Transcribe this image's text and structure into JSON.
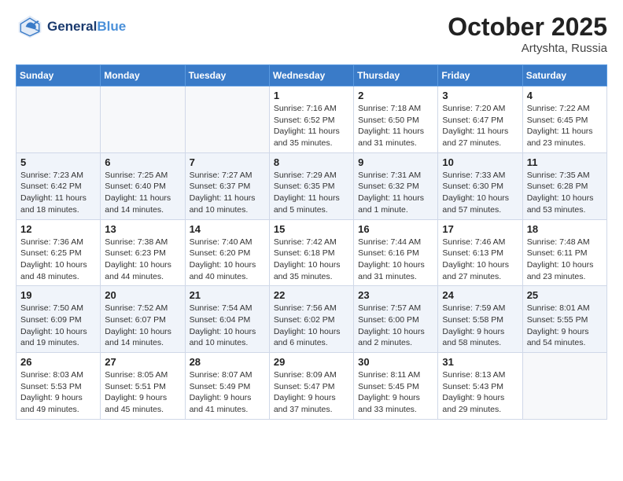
{
  "logo": {
    "line1": "General",
    "line2": "Blue"
  },
  "title": "October 2025",
  "location": "Artyshta, Russia",
  "weekdays": [
    "Sunday",
    "Monday",
    "Tuesday",
    "Wednesday",
    "Thursday",
    "Friday",
    "Saturday"
  ],
  "weeks": [
    [
      {
        "day": "",
        "info": ""
      },
      {
        "day": "",
        "info": ""
      },
      {
        "day": "",
        "info": ""
      },
      {
        "day": "1",
        "info": "Sunrise: 7:16 AM\nSunset: 6:52 PM\nDaylight: 11 hours\nand 35 minutes."
      },
      {
        "day": "2",
        "info": "Sunrise: 7:18 AM\nSunset: 6:50 PM\nDaylight: 11 hours\nand 31 minutes."
      },
      {
        "day": "3",
        "info": "Sunrise: 7:20 AM\nSunset: 6:47 PM\nDaylight: 11 hours\nand 27 minutes."
      },
      {
        "day": "4",
        "info": "Sunrise: 7:22 AM\nSunset: 6:45 PM\nDaylight: 11 hours\nand 23 minutes."
      }
    ],
    [
      {
        "day": "5",
        "info": "Sunrise: 7:23 AM\nSunset: 6:42 PM\nDaylight: 11 hours\nand 18 minutes."
      },
      {
        "day": "6",
        "info": "Sunrise: 7:25 AM\nSunset: 6:40 PM\nDaylight: 11 hours\nand 14 minutes."
      },
      {
        "day": "7",
        "info": "Sunrise: 7:27 AM\nSunset: 6:37 PM\nDaylight: 11 hours\nand 10 minutes."
      },
      {
        "day": "8",
        "info": "Sunrise: 7:29 AM\nSunset: 6:35 PM\nDaylight: 11 hours\nand 5 minutes."
      },
      {
        "day": "9",
        "info": "Sunrise: 7:31 AM\nSunset: 6:32 PM\nDaylight: 11 hours\nand 1 minute."
      },
      {
        "day": "10",
        "info": "Sunrise: 7:33 AM\nSunset: 6:30 PM\nDaylight: 10 hours\nand 57 minutes."
      },
      {
        "day": "11",
        "info": "Sunrise: 7:35 AM\nSunset: 6:28 PM\nDaylight: 10 hours\nand 53 minutes."
      }
    ],
    [
      {
        "day": "12",
        "info": "Sunrise: 7:36 AM\nSunset: 6:25 PM\nDaylight: 10 hours\nand 48 minutes."
      },
      {
        "day": "13",
        "info": "Sunrise: 7:38 AM\nSunset: 6:23 PM\nDaylight: 10 hours\nand 44 minutes."
      },
      {
        "day": "14",
        "info": "Sunrise: 7:40 AM\nSunset: 6:20 PM\nDaylight: 10 hours\nand 40 minutes."
      },
      {
        "day": "15",
        "info": "Sunrise: 7:42 AM\nSunset: 6:18 PM\nDaylight: 10 hours\nand 35 minutes."
      },
      {
        "day": "16",
        "info": "Sunrise: 7:44 AM\nSunset: 6:16 PM\nDaylight: 10 hours\nand 31 minutes."
      },
      {
        "day": "17",
        "info": "Sunrise: 7:46 AM\nSunset: 6:13 PM\nDaylight: 10 hours\nand 27 minutes."
      },
      {
        "day": "18",
        "info": "Sunrise: 7:48 AM\nSunset: 6:11 PM\nDaylight: 10 hours\nand 23 minutes."
      }
    ],
    [
      {
        "day": "19",
        "info": "Sunrise: 7:50 AM\nSunset: 6:09 PM\nDaylight: 10 hours\nand 19 minutes."
      },
      {
        "day": "20",
        "info": "Sunrise: 7:52 AM\nSunset: 6:07 PM\nDaylight: 10 hours\nand 14 minutes."
      },
      {
        "day": "21",
        "info": "Sunrise: 7:54 AM\nSunset: 6:04 PM\nDaylight: 10 hours\nand 10 minutes."
      },
      {
        "day": "22",
        "info": "Sunrise: 7:56 AM\nSunset: 6:02 PM\nDaylight: 10 hours\nand 6 minutes."
      },
      {
        "day": "23",
        "info": "Sunrise: 7:57 AM\nSunset: 6:00 PM\nDaylight: 10 hours\nand 2 minutes."
      },
      {
        "day": "24",
        "info": "Sunrise: 7:59 AM\nSunset: 5:58 PM\nDaylight: 9 hours\nand 58 minutes."
      },
      {
        "day": "25",
        "info": "Sunrise: 8:01 AM\nSunset: 5:55 PM\nDaylight: 9 hours\nand 54 minutes."
      }
    ],
    [
      {
        "day": "26",
        "info": "Sunrise: 8:03 AM\nSunset: 5:53 PM\nDaylight: 9 hours\nand 49 minutes."
      },
      {
        "day": "27",
        "info": "Sunrise: 8:05 AM\nSunset: 5:51 PM\nDaylight: 9 hours\nand 45 minutes."
      },
      {
        "day": "28",
        "info": "Sunrise: 8:07 AM\nSunset: 5:49 PM\nDaylight: 9 hours\nand 41 minutes."
      },
      {
        "day": "29",
        "info": "Sunrise: 8:09 AM\nSunset: 5:47 PM\nDaylight: 9 hours\nand 37 minutes."
      },
      {
        "day": "30",
        "info": "Sunrise: 8:11 AM\nSunset: 5:45 PM\nDaylight: 9 hours\nand 33 minutes."
      },
      {
        "day": "31",
        "info": "Sunrise: 8:13 AM\nSunset: 5:43 PM\nDaylight: 9 hours\nand 29 minutes."
      },
      {
        "day": "",
        "info": ""
      }
    ]
  ]
}
